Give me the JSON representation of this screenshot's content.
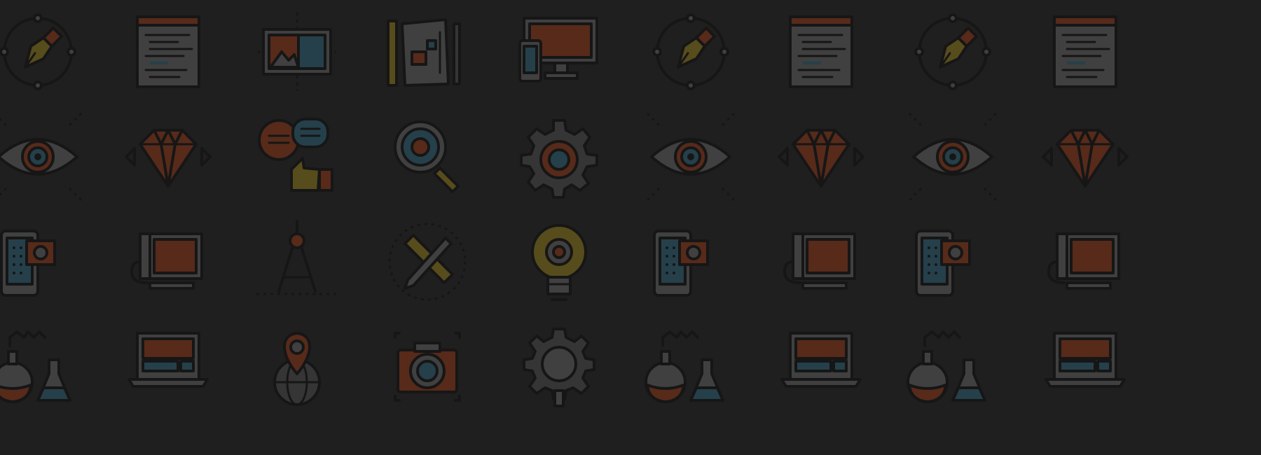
{
  "colors": {
    "background": "#1f1f1f",
    "outline": "#0c0c0c",
    "paper": "#6f6f6f",
    "red": "#a43a14",
    "teal": "#2f6f86",
    "yellow": "#a58a16",
    "gray": "#555555"
  },
  "pattern": {
    "rows": [
      [
        "pen-tool-icon",
        "code-editor-icon",
        "image-artboard-icon",
        "design-sheet-icon",
        "devices-icon",
        "pen-tool-icon",
        "code-editor-icon",
        "pen-tool-icon",
        "code-editor-icon"
      ],
      [
        "eye-icon",
        "diamond-icon",
        "chat-thumbs-up-icon",
        "magnifier-icon",
        "gear-icon",
        "eye-icon",
        "diamond-icon",
        "eye-icon",
        "diamond-icon"
      ],
      [
        "mobile-settings-icon",
        "monitor-icon",
        "compass-icon",
        "pencil-ruler-icon",
        "lightbulb-gear-icon",
        "mobile-settings-icon",
        "monitor-icon",
        "mobile-settings-icon",
        "monitor-icon"
      ],
      [
        "lab-flasks-icon",
        "laptop-icon",
        "globe-pin-icon",
        "camera-icon",
        "gear-search-icon",
        "lab-flasks-icon",
        "laptop-icon",
        "lab-flasks-icon",
        "laptop-icon"
      ]
    ]
  }
}
